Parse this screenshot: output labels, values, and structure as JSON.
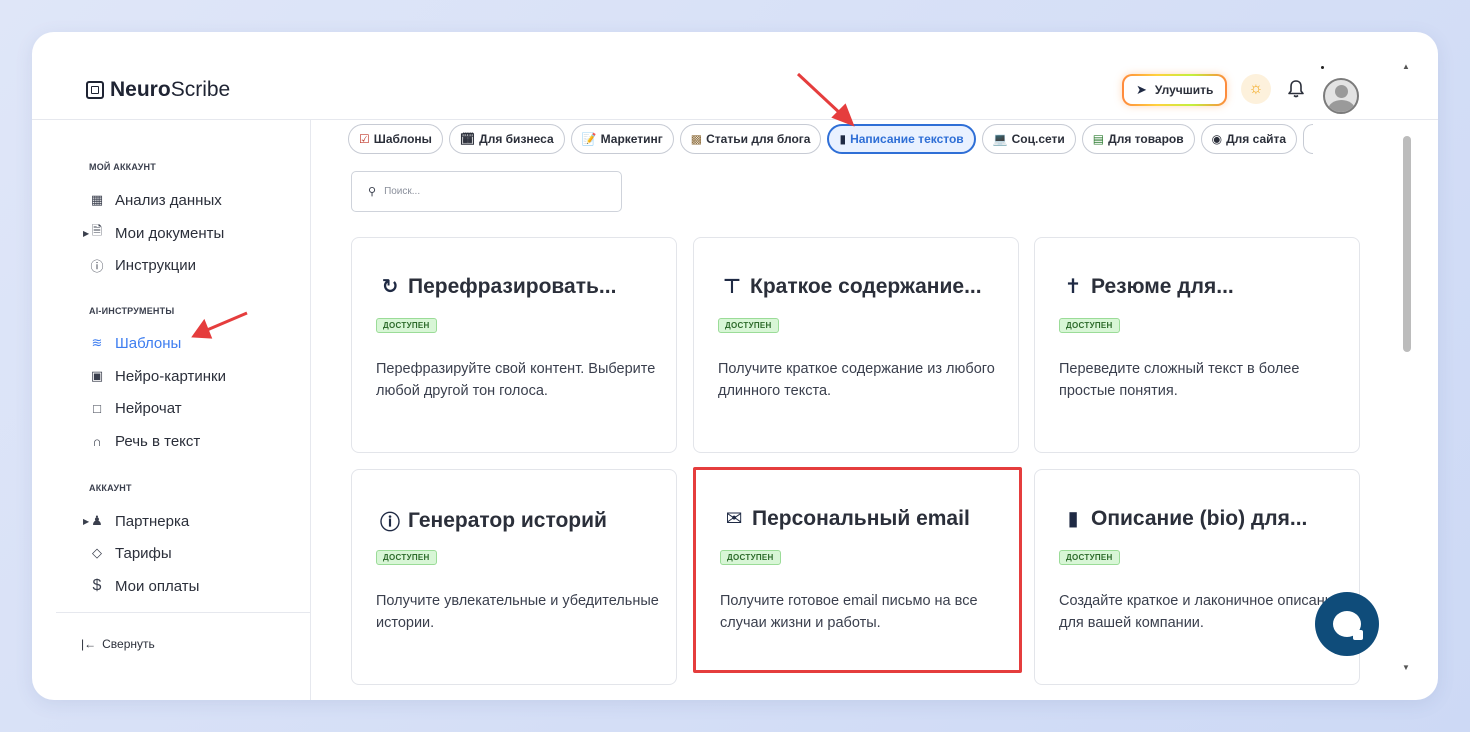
{
  "brand": {
    "bold": "Neuro",
    "regular": "Scribe"
  },
  "header": {
    "upgrade_label": "Улучшить"
  },
  "sidebar": {
    "sections": [
      {
        "title": "МОЙ АККАУНТ"
      },
      {
        "title": "AI-ИНСТРУМЕНТЫ"
      },
      {
        "title": "АККАУНТ"
      }
    ],
    "items": [
      {
        "label": "Анализ данных",
        "icon": "grid-icon"
      },
      {
        "label": "Мои документы",
        "icon": "document-icon"
      },
      {
        "label": "Инструкции",
        "icon": "help-circle-icon"
      },
      {
        "label": "Шаблоны",
        "icon": "layers-icon",
        "active": true
      },
      {
        "label": "Нейро-картинки",
        "icon": "image-icon"
      },
      {
        "label": "Нейрочат",
        "icon": "chat-icon"
      },
      {
        "label": "Речь в текст",
        "icon": "headphones-icon"
      },
      {
        "label": "Партнерка",
        "icon": "users-icon"
      },
      {
        "label": "Тарифы",
        "icon": "tag-icon"
      },
      {
        "label": "Мои оплаты",
        "icon": "dollar-icon"
      }
    ],
    "collapse_label": "Свернуть"
  },
  "categories": [
    {
      "label": "Шаблоны",
      "icon": "checkbox-icon"
    },
    {
      "label": "Для бизнеса",
      "icon": "calendar-icon"
    },
    {
      "label": "Маркетинг",
      "icon": "memo-icon"
    },
    {
      "label": "Статьи для блога",
      "icon": "city-icon"
    },
    {
      "label": "Написание текстов",
      "icon": "phone-icon",
      "active": true
    },
    {
      "label": "Соц.сети",
      "icon": "laptop-icon"
    },
    {
      "label": "Для товаров",
      "icon": "ledger-icon"
    },
    {
      "label": "Для сайта",
      "icon": "robot-icon"
    }
  ],
  "search": {
    "placeholder": "Поиск..."
  },
  "cards": [
    {
      "title": "Перефразировать...",
      "icon": "refresh-icon",
      "badge": "ДОСТУПЕН",
      "desc": "Перефразируйте свой контент. Выберите любой другой тон голоса."
    },
    {
      "title": "Краткое содержание...",
      "icon": "summary-icon",
      "badge": "ДОСТУПЕН",
      "desc": "Получите краткое содержание из любого длинного текста."
    },
    {
      "title": "Резюме для...",
      "icon": "person-icon",
      "badge": "ДОСТУПЕН",
      "desc": "Переведите сложный текст в более простые понятия."
    },
    {
      "title": "Генератор историй",
      "icon": "question-icon",
      "badge": "ДОСТУПЕН",
      "desc": "Получите увлекательные и убедительные истории."
    },
    {
      "title": "Персональный email",
      "icon": "envelope-icon",
      "badge": "ДОСТУПЕН",
      "desc": "Получите готовое email письмо на все случаи жизни и работы.",
      "highlighted": true
    },
    {
      "title": "Описание (bio) для...",
      "icon": "file-icon",
      "badge": "ДОСТУПЕН",
      "desc": "Создайте краткое и лаконичное описание для вашей компании."
    }
  ],
  "colors": {
    "accent": "#3d7df0",
    "active_tab": "#2f6fd6",
    "badge_bg": "#d8f6d6",
    "annotation": "#e53d3d",
    "chat_fab": "#0f4c7a"
  }
}
